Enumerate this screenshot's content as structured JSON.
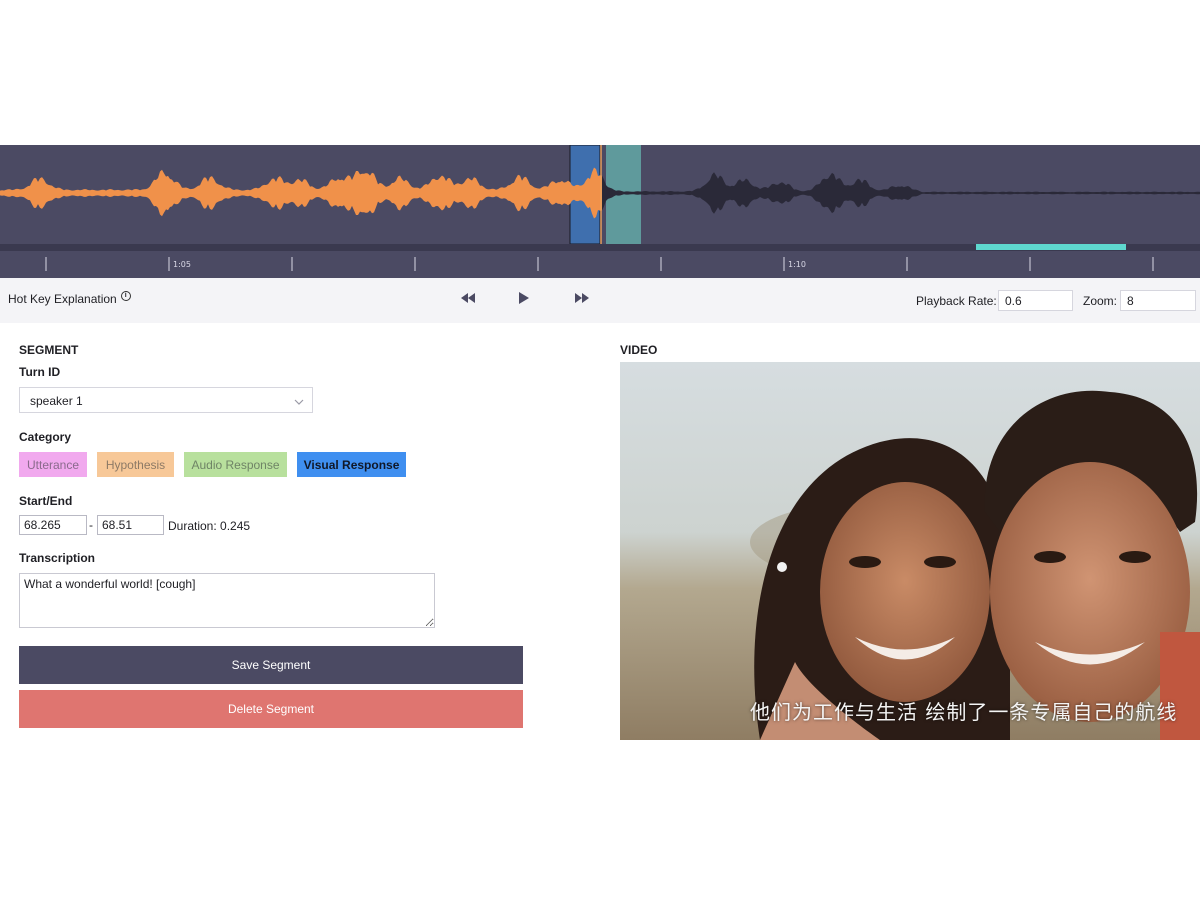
{
  "waveform": {
    "played_color": "#f0914a",
    "unplayed_color": "#2a2938",
    "background_color": "#4b4a63",
    "region_active_color": "#3f6fae",
    "region_other_color": "#5f9a9c",
    "tick_labels": [
      "1:05",
      "1:10"
    ]
  },
  "transport": {
    "hotkey_label": "Hot Key Explanation",
    "info_icon": "info-circle-icon",
    "rewind_icon": "rewind-icon",
    "play_icon": "play-icon",
    "forward_icon": "fast-forward-icon",
    "playback_rate_label": "Playback Rate:",
    "playback_rate_value": "0.6",
    "zoom_label": "Zoom:",
    "zoom_value": "8"
  },
  "segment": {
    "title": "SEGMENT",
    "turn_id_label": "Turn ID",
    "turn_id_value": "speaker 1",
    "category_label": "Category",
    "categories": [
      "Utterance",
      "Hypothesis",
      "Audio Response",
      "Visual Response"
    ],
    "selected_category": "Visual Response",
    "start_end_label": "Start/End",
    "start_value": "68.265",
    "end_value": "68.51",
    "dash": "-",
    "duration_text": "Duration: 0.245",
    "transcription_label": "Transcription",
    "transcription_value": "What a wonderful world! [cough]",
    "save_label": "Save Segment",
    "delete_label": "Delete Segment"
  },
  "video": {
    "title": "VIDEO",
    "subtitle": "他们为工作与生活  绘制了一条专属自己的航线"
  }
}
